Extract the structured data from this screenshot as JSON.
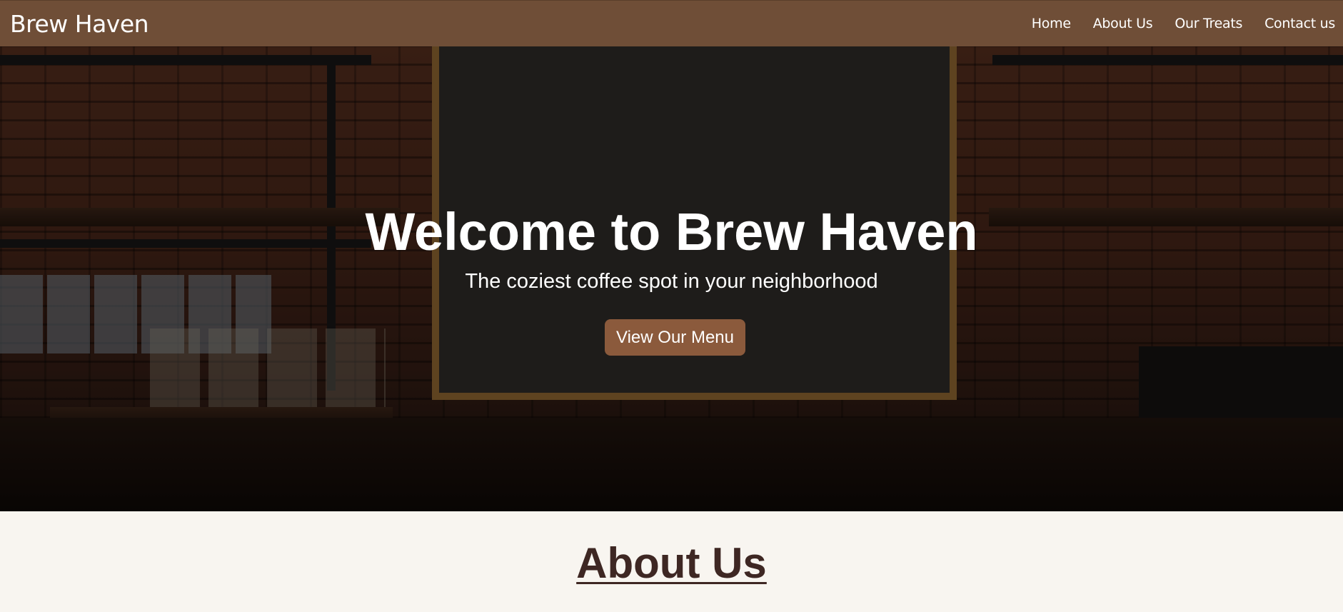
{
  "navbar": {
    "brand": "Brew Haven",
    "links": [
      "Home",
      "About Us",
      "Our Treats",
      "Contact us"
    ]
  },
  "hero": {
    "background_description_icon": "coffee-shop-photo",
    "title": "Welcome to Brew Haven",
    "subtitle": "The coziest coffee spot in your neighborhood",
    "button_label": "View Our Menu"
  },
  "about": {
    "title": "About Us"
  },
  "colors": {
    "nav_bg": "#6f4e37",
    "button_bg": "#8b5a3c",
    "page_bg": "#f8f5f0",
    "heading_dark": "#3e2723",
    "text_light": "#ffffff"
  }
}
